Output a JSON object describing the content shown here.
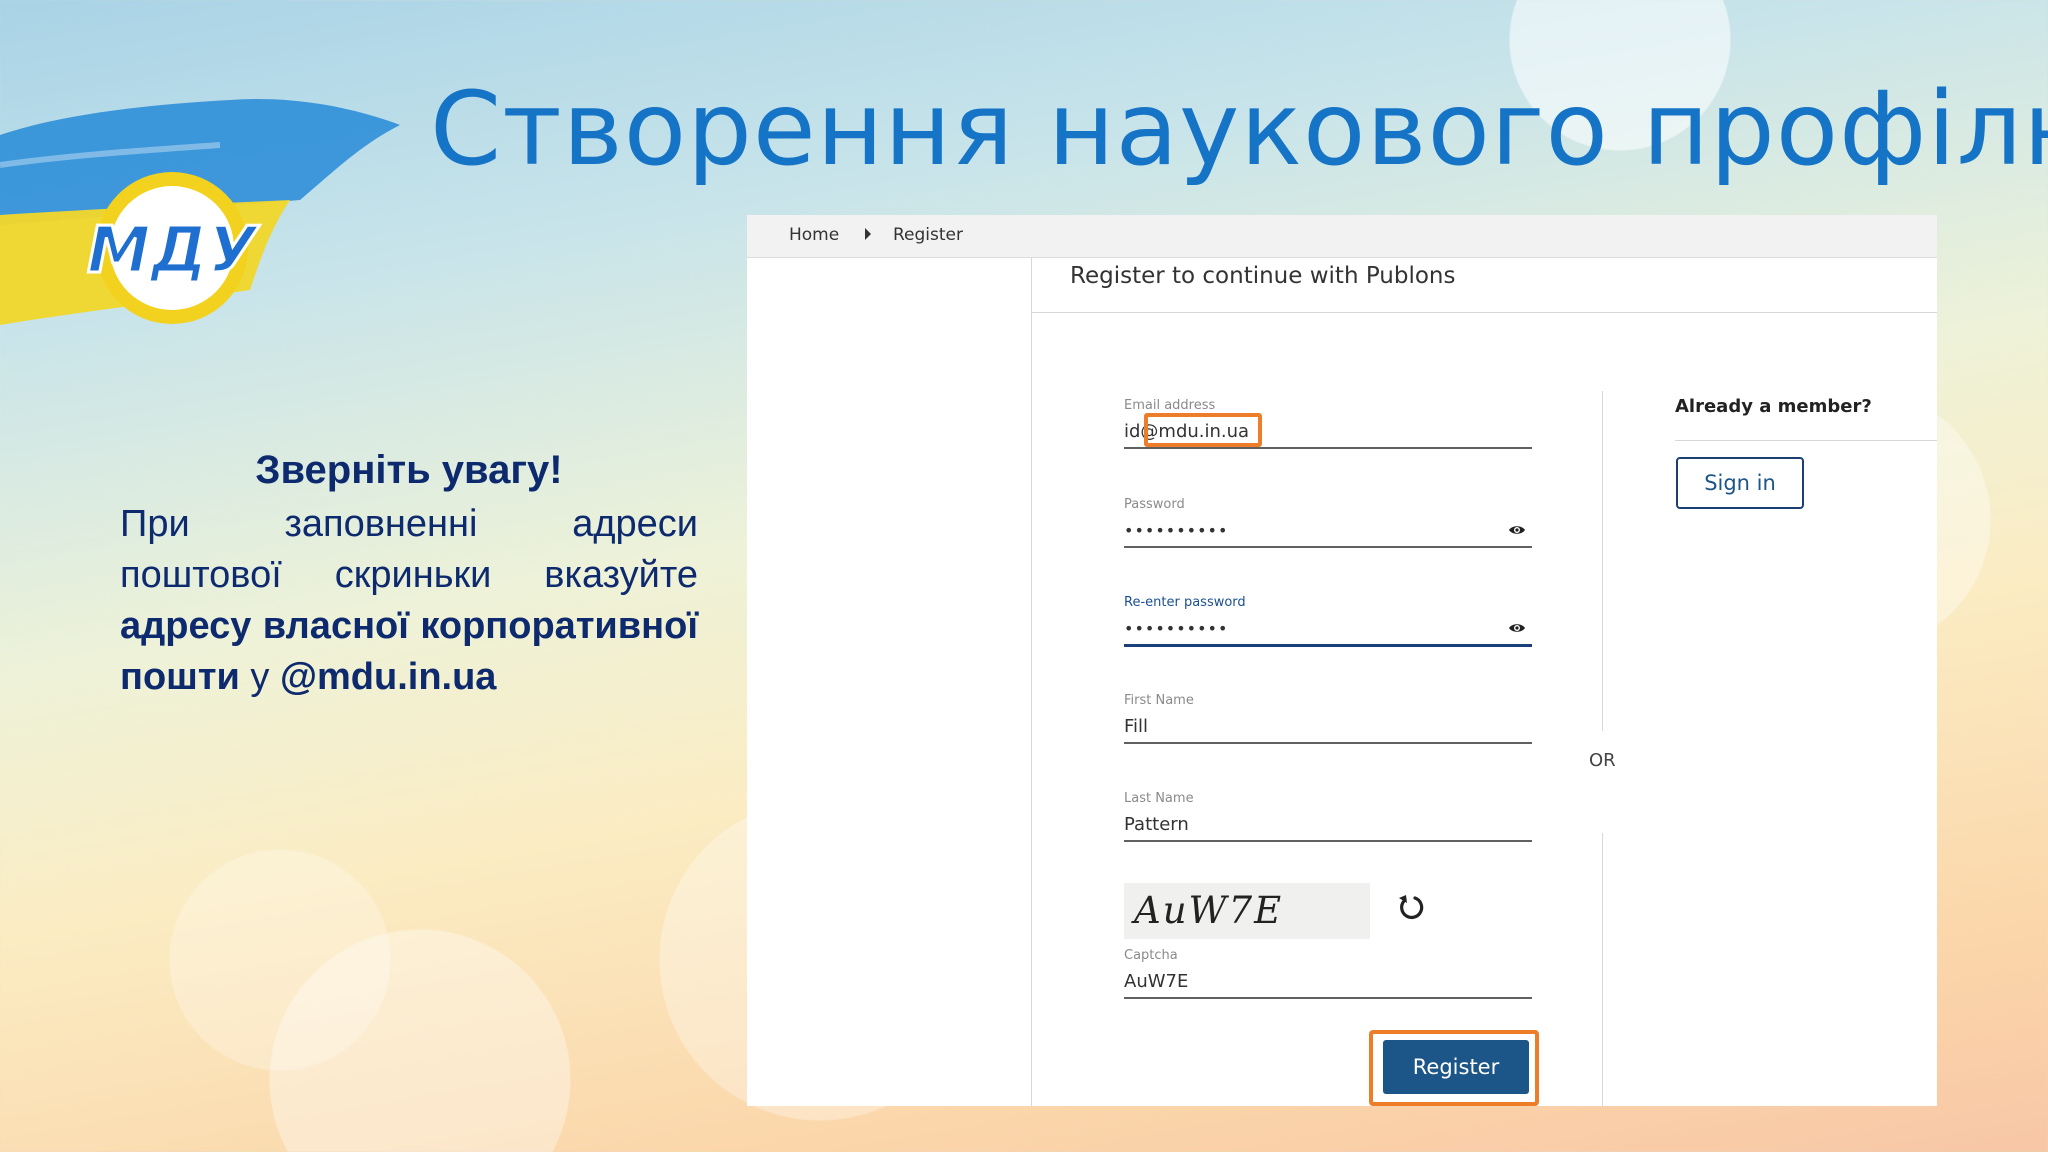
{
  "slide": {
    "title": "Створення наукового профілю",
    "logo_text": "МДУ",
    "note_heading": "Зверніть увагу!",
    "note_text_1": "При заповненні адреси поштової скриньки вказуйте ",
    "note_text_bold": "адресу власної корпоративної пошти ",
    "note_text_2": "у ",
    "note_text_domain": "@mdu.in.ua"
  },
  "breadcrumb": {
    "home": "Home",
    "current": "Register"
  },
  "form": {
    "title": "Register to continue with Publons",
    "email_label": "Email address",
    "email_value": "id@mdu.in.ua",
    "password_label": "Password",
    "password_value": "••••••••••",
    "reenter_label": "Re-enter password",
    "reenter_value": "••••••••••",
    "first_name_label": "First Name",
    "first_name_value": "Fill",
    "last_name_label": "Last Name",
    "last_name_value": "Pattern",
    "captcha_image_text": "AuW7E",
    "captcha_label": "Captcha",
    "captcha_value": "AuW7E",
    "register_label": "Register"
  },
  "divider": {
    "or_label": "OR"
  },
  "member": {
    "title": "Already a member?",
    "signin_label": "Sign in"
  },
  "colors": {
    "title_blue": "#1674c7",
    "note_navy": "#0d2a6e",
    "highlight_orange": "#ee7d2a",
    "register_button": "#1c5587"
  }
}
